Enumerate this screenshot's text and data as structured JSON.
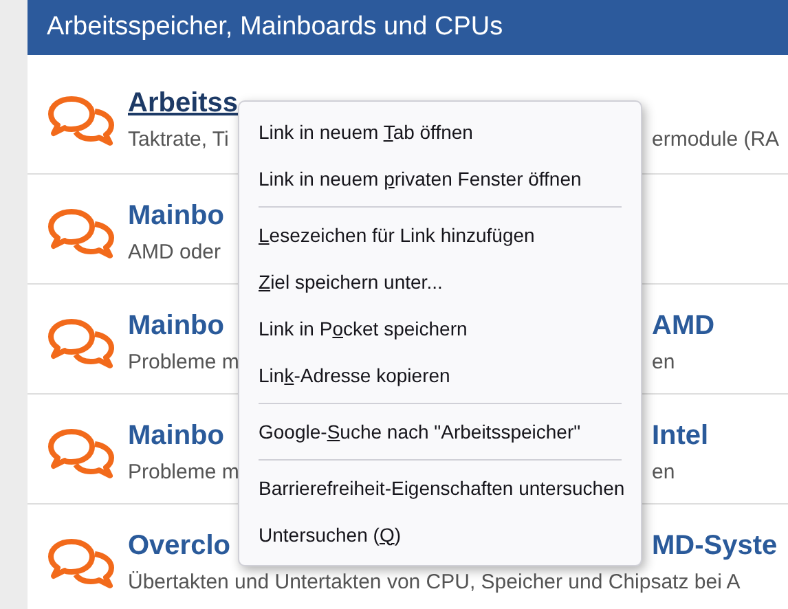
{
  "header": {
    "title": "Arbeitsspeicher, Mainboards und CPUs"
  },
  "forums": [
    {
      "title_start": "Arbeitss",
      "underlined": true,
      "description_start": "Taktrate, Ti",
      "description_end": "ermodule (RA"
    },
    {
      "title_start": "Mainbo",
      "underlined": false,
      "description_start": "AMD oder"
    },
    {
      "title_start": "Mainbo",
      "title_end": "AMD",
      "underlined": false,
      "description_start": "Probleme m",
      "description_end": "en"
    },
    {
      "title_start": "Mainbo",
      "title_end": "Intel",
      "underlined": false,
      "description_start": "Probleme m",
      "description_end": "en"
    },
    {
      "title_start": "Overclo",
      "title_end": "MD-Syste",
      "underlined": false,
      "description_start": "Übertakten und Untertakten von CPU, Speicher und Chipsatz bei A"
    }
  ],
  "context_menu": [
    {
      "kind": "item",
      "pre": "Link in neuem ",
      "key": "T",
      "post": "ab öffnen"
    },
    {
      "kind": "item",
      "pre": "Link in neuem ",
      "key": "p",
      "post": "rivaten Fenster öffnen"
    },
    {
      "kind": "separator"
    },
    {
      "kind": "item",
      "key": "L",
      "post": "esezeichen für Link hinzufügen"
    },
    {
      "kind": "item",
      "key": "Z",
      "post": "iel speichern unter..."
    },
    {
      "kind": "item",
      "pre": "Link in P",
      "key": "o",
      "post": "cket speichern"
    },
    {
      "kind": "item",
      "pre": "Lin",
      "key": "k",
      "post": "-Adresse kopieren"
    },
    {
      "kind": "separator"
    },
    {
      "kind": "item",
      "pre": "Google-",
      "key": "S",
      "post": "uche nach \"Arbeitsspeicher\""
    },
    {
      "kind": "separator"
    },
    {
      "kind": "item",
      "pre": "Barrierefreiheit-Eigenschaften untersuchen"
    },
    {
      "kind": "item",
      "pre": "Untersuchen (",
      "key": "Q",
      "post": ")"
    }
  ]
}
